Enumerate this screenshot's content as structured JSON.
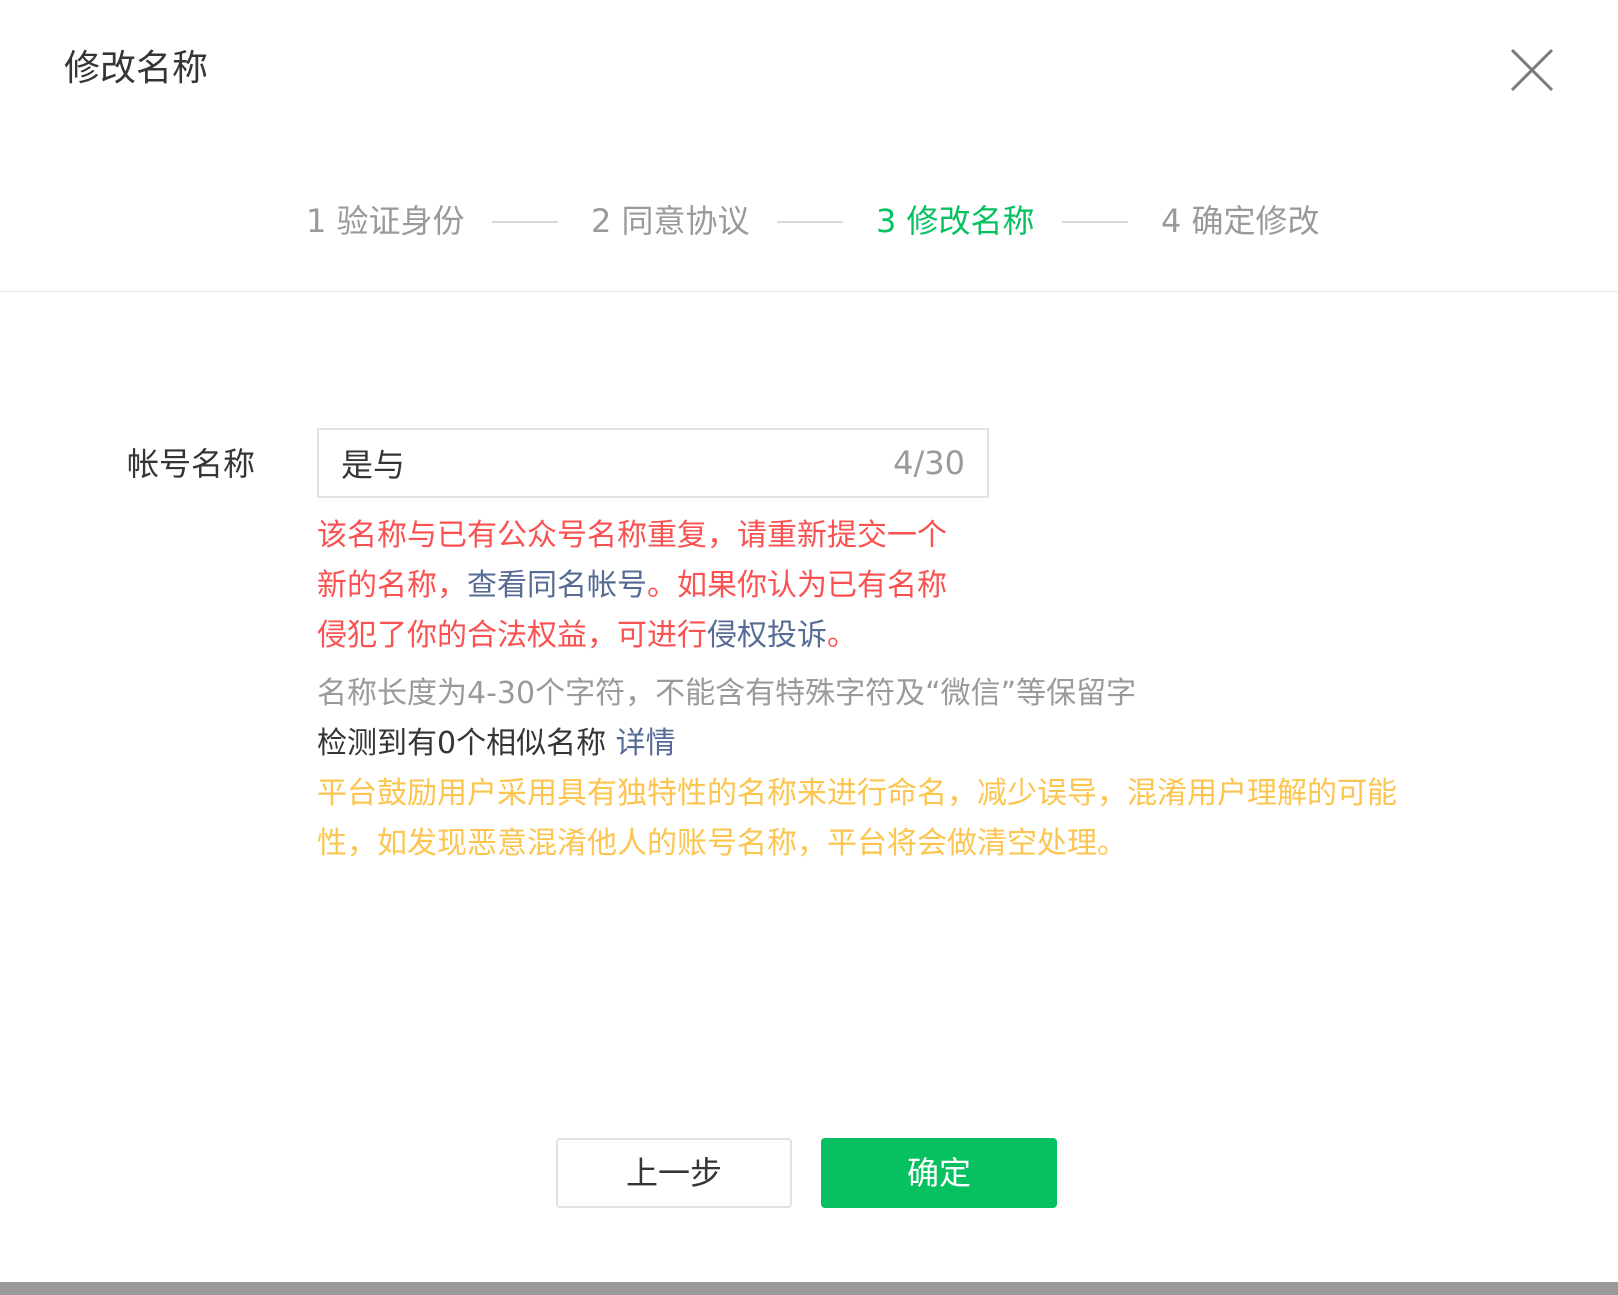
{
  "dialog": {
    "title": "修改名称"
  },
  "steps": [
    {
      "label": "1 验证身份",
      "active": false
    },
    {
      "label": "2 同意协议",
      "active": false
    },
    {
      "label": "3 修改名称",
      "active": true
    },
    {
      "label": "4 确定修改",
      "active": false
    }
  ],
  "form": {
    "label": "帐号名称",
    "value": "是与",
    "char_count": "4/30"
  },
  "error": {
    "line1": "该名称与已有公众号名称重复，请重新提交一个",
    "line2_pre": "新的名称，",
    "line2_link": "查看同名帐号",
    "line2_post": "。如果你认为已有名称",
    "line3_pre": "侵犯了你的合法权益，可进行",
    "line3_link": "侵权投诉",
    "line3_post": "。"
  },
  "hint": "名称长度为4-30个字符，不能含有特殊字符及“微信”等保留字",
  "similar": {
    "text": "检测到有0个相似名称 ",
    "link": "详情"
  },
  "warning": {
    "line1": "平台鼓励用户采用具有独特性的名称来进行命名，减少误导，混淆用户理解的可能",
    "line2": "性，如发现恶意混淆他人的账号名称，平台将会做清空处理。"
  },
  "buttons": {
    "back": "上一步",
    "confirm": "确定"
  },
  "colors": {
    "accent": "#07c160",
    "error": "#fa5151",
    "link": "#576b95",
    "warning": "#fcc54f",
    "muted": "#9a9a9a"
  },
  "icons": {
    "close": "close-icon"
  }
}
